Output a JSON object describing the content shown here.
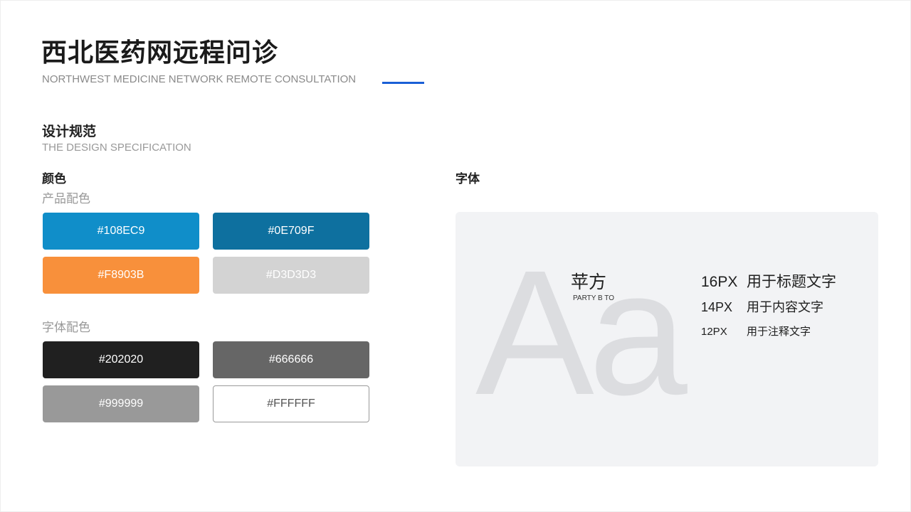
{
  "header": {
    "title": "西北医药网远程问诊",
    "subtitle": "NORTHWEST MEDICINE NETWORK REMOTE CONSULTATION",
    "accent_color": "#1a5fd6"
  },
  "section": {
    "title": "设计规范",
    "subtitle": "THE DESIGN SPECIFICATION"
  },
  "colors": {
    "heading": "颜色",
    "product_label": "产品配色",
    "product": [
      {
        "label": "#108EC9",
        "hex": "#108EC9"
      },
      {
        "label": "#0E709F",
        "hex": "#0E709F"
      },
      {
        "label": "#F8903B",
        "hex": "#F8903B"
      },
      {
        "label": "#D3D3D3",
        "hex": "#D3D3D3"
      }
    ],
    "text_label": "字体配色",
    "text": [
      {
        "label": "#202020",
        "hex": "#202020"
      },
      {
        "label": "#666666",
        "hex": "#666666"
      },
      {
        "label": "#999999",
        "hex": "#999999"
      },
      {
        "label": "#FFFFFF",
        "hex": "#FFFFFF"
      }
    ]
  },
  "typography": {
    "heading": "字体",
    "sample_glyphs": "Aa",
    "font_name": "苹方",
    "font_name_sub": "PARTY B TO",
    "specs": [
      {
        "size": "16PX",
        "usage": "用于标题文字"
      },
      {
        "size": "14PX",
        "usage": "用于内容文字"
      },
      {
        "size": "12PX",
        "usage": "用于注释文字"
      }
    ]
  }
}
